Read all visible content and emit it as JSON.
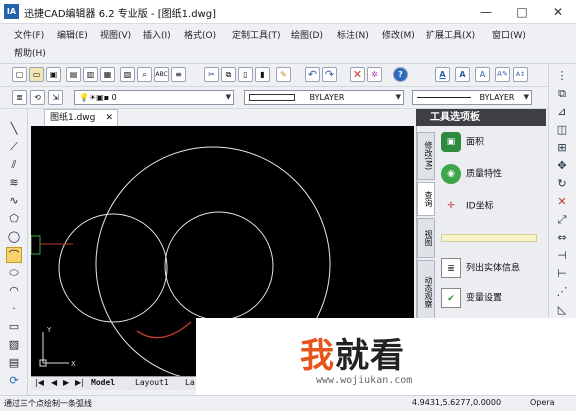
{
  "window": {
    "title": "迅捷CAD编辑器 6.2 专业版 - [图纸1.dwg]",
    "app_icon_text": "IA",
    "controls": [
      "—",
      "□",
      "✕"
    ]
  },
  "menu": [
    "文件(F)",
    "编辑(E)",
    "视图(V)",
    "插入(I)",
    "格式(O)",
    "定制工具(T)",
    "绘图(D)",
    "标注(N)",
    "修改(M)",
    "扩展工具(X)",
    "窗口(W)",
    "帮助(H)"
  ],
  "toolbar2": {
    "layer_value": "0",
    "linetype_value": "BYLAYER",
    "lineweight_value": "BYLAYER"
  },
  "document": {
    "tab_label": "图纸1.dwg",
    "tab_close": "✕"
  },
  "canvas": {
    "background": "#000000",
    "stroke": "#e8e8e8",
    "arc_color": "#c0392b",
    "ucs_x": "X",
    "ucs_y": "Y"
  },
  "layout_tabs": {
    "nav": [
      "|◀",
      "◀",
      "▶",
      "▶|"
    ],
    "tabs": [
      "Model",
      "Layout1",
      "La"
    ]
  },
  "palette": {
    "title": "工具选项板",
    "side_tabs": [
      "修改(M)",
      "查询",
      "视图",
      "动态观察"
    ],
    "items": [
      {
        "label": "面积",
        "icon": "area-icon"
      },
      {
        "label": "质量特性",
        "icon": "mass-properties-icon"
      },
      {
        "label": "ID坐标",
        "icon": "id-coordinate-icon"
      },
      {
        "label": "列出实体信息",
        "icon": "list-entity-icon"
      },
      {
        "label": "变量设置",
        "icon": "variable-settings-icon"
      }
    ]
  },
  "status": {
    "prompt": "通过三个点绘制一条弧线",
    "coords": "4.9431,5.6277,0.0000",
    "right": "Opera"
  },
  "watermark": {
    "text": "我就看",
    "url": "www.wojiukan.com"
  }
}
